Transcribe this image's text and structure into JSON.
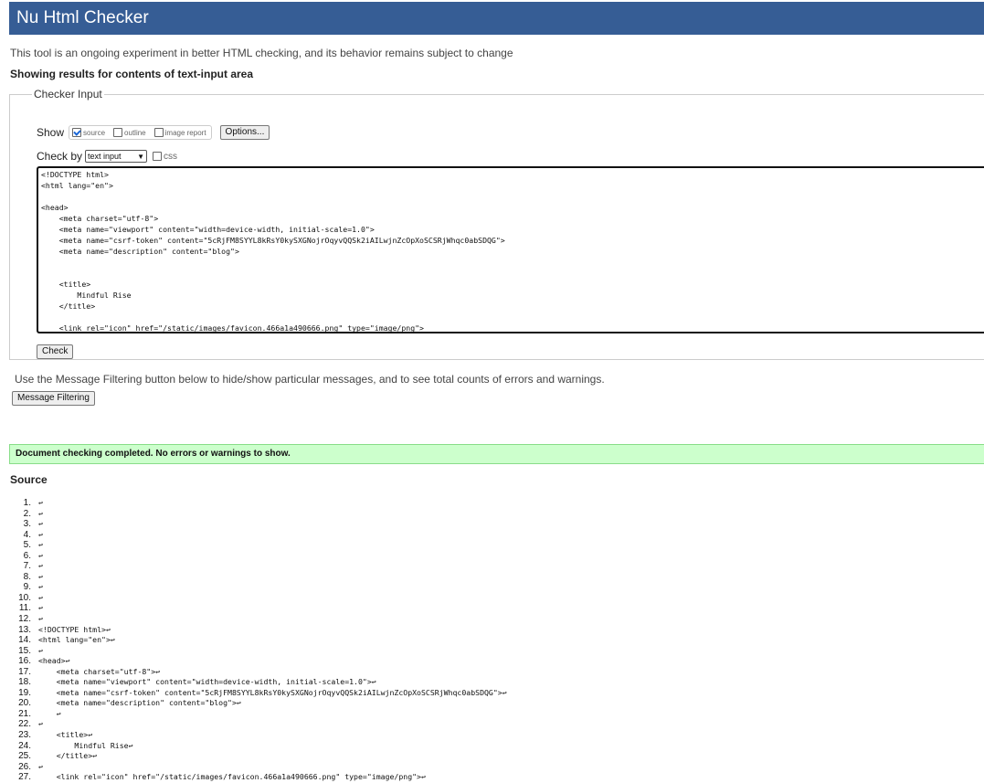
{
  "header": {
    "title": "Nu Html Checker"
  },
  "intro": "This tool is an ongoing experiment in better HTML checking, and its behavior remains subject to change",
  "showing": "Showing results for contents of text-input area",
  "checker": {
    "legend": "Checker Input",
    "show_label": "Show",
    "show_options": [
      {
        "label": "source",
        "checked": true
      },
      {
        "label": "outline",
        "checked": false
      },
      {
        "label": "image report",
        "checked": false
      }
    ],
    "options_button": "Options...",
    "check_by_label": "Check by",
    "check_by_value": "text input",
    "css_label": "css",
    "check_button": "Check",
    "textarea_lines": [
      "<!DOCTYPE html>",
      "<html lang=\"en\">",
      "",
      "<head>",
      "    <meta charset=\"utf-8\">",
      "    <meta name=\"viewport\" content=\"width=device-width, initial-scale=1.0\">",
      "    <meta name=\"csrf-token\" content=\"5cRjFM8SYYL8kRsY0kySXGNojrOqyvQQSk2iAILwjnZcOpXoSCSRjWhqc0abSDQG\">",
      "    <meta name=\"description\" content=\"blog\">",
      "",
      "",
      "    <title>",
      "        Mindful Rise",
      "    </title>",
      "",
      "    <link rel=\"icon\" href=\"/static/images/favicon.466a1a490666.png\" type=\"image/png\">"
    ]
  },
  "filter_note": "Use the Message Filtering button below to hide/show particular messages, and to see total counts of errors and warnings.",
  "filter_button": "Message Filtering",
  "result": "Document checking completed. No errors or warnings to show.",
  "source_heading": "Source",
  "source_lines": [
    {
      "num": "1.",
      "code": "↩"
    },
    {
      "num": "2.",
      "code": "↩"
    },
    {
      "num": "3.",
      "code": "↩"
    },
    {
      "num": "4.",
      "code": "↩"
    },
    {
      "num": "5.",
      "code": "↩"
    },
    {
      "num": "6.",
      "code": "↩"
    },
    {
      "num": "7.",
      "code": "↩"
    },
    {
      "num": "8.",
      "code": "↩"
    },
    {
      "num": "9.",
      "code": "↩"
    },
    {
      "num": "10.",
      "code": "↩"
    },
    {
      "num": "11.",
      "code": "↩"
    },
    {
      "num": "12.",
      "code": "↩"
    },
    {
      "num": "13.",
      "code": "<!DOCTYPE html>↩"
    },
    {
      "num": "14.",
      "code": "<html lang=\"en\">↩"
    },
    {
      "num": "15.",
      "code": "↩"
    },
    {
      "num": "16.",
      "code": "<head>↩"
    },
    {
      "num": "17.",
      "code": "    <meta charset=\"utf-8\">↩"
    },
    {
      "num": "18.",
      "code": "    <meta name=\"viewport\" content=\"width=device-width, initial-scale=1.0\">↩"
    },
    {
      "num": "19.",
      "code": "    <meta name=\"csrf-token\" content=\"5cRjFM8SYYL8kRsY0kySXGNojrOqyvQQSk2iAILwjnZcOpXoSCSRjWhqc0abSDQG\">↩"
    },
    {
      "num": "20.",
      "code": "    <meta name=\"description\" content=\"blog\">↩"
    },
    {
      "num": "21.",
      "code": "    ↩"
    },
    {
      "num": "22.",
      "code": "↩"
    },
    {
      "num": "23.",
      "code": "    <title>↩"
    },
    {
      "num": "24.",
      "code": "        Mindful Rise↩"
    },
    {
      "num": "25.",
      "code": "    </title>↩"
    },
    {
      "num": "26.",
      "code": "↩"
    },
    {
      "num": "27.",
      "code": "    <link rel=\"icon\" href=\"/static/images/favicon.466a1a490666.png\" type=\"image/png\">↩"
    }
  ]
}
